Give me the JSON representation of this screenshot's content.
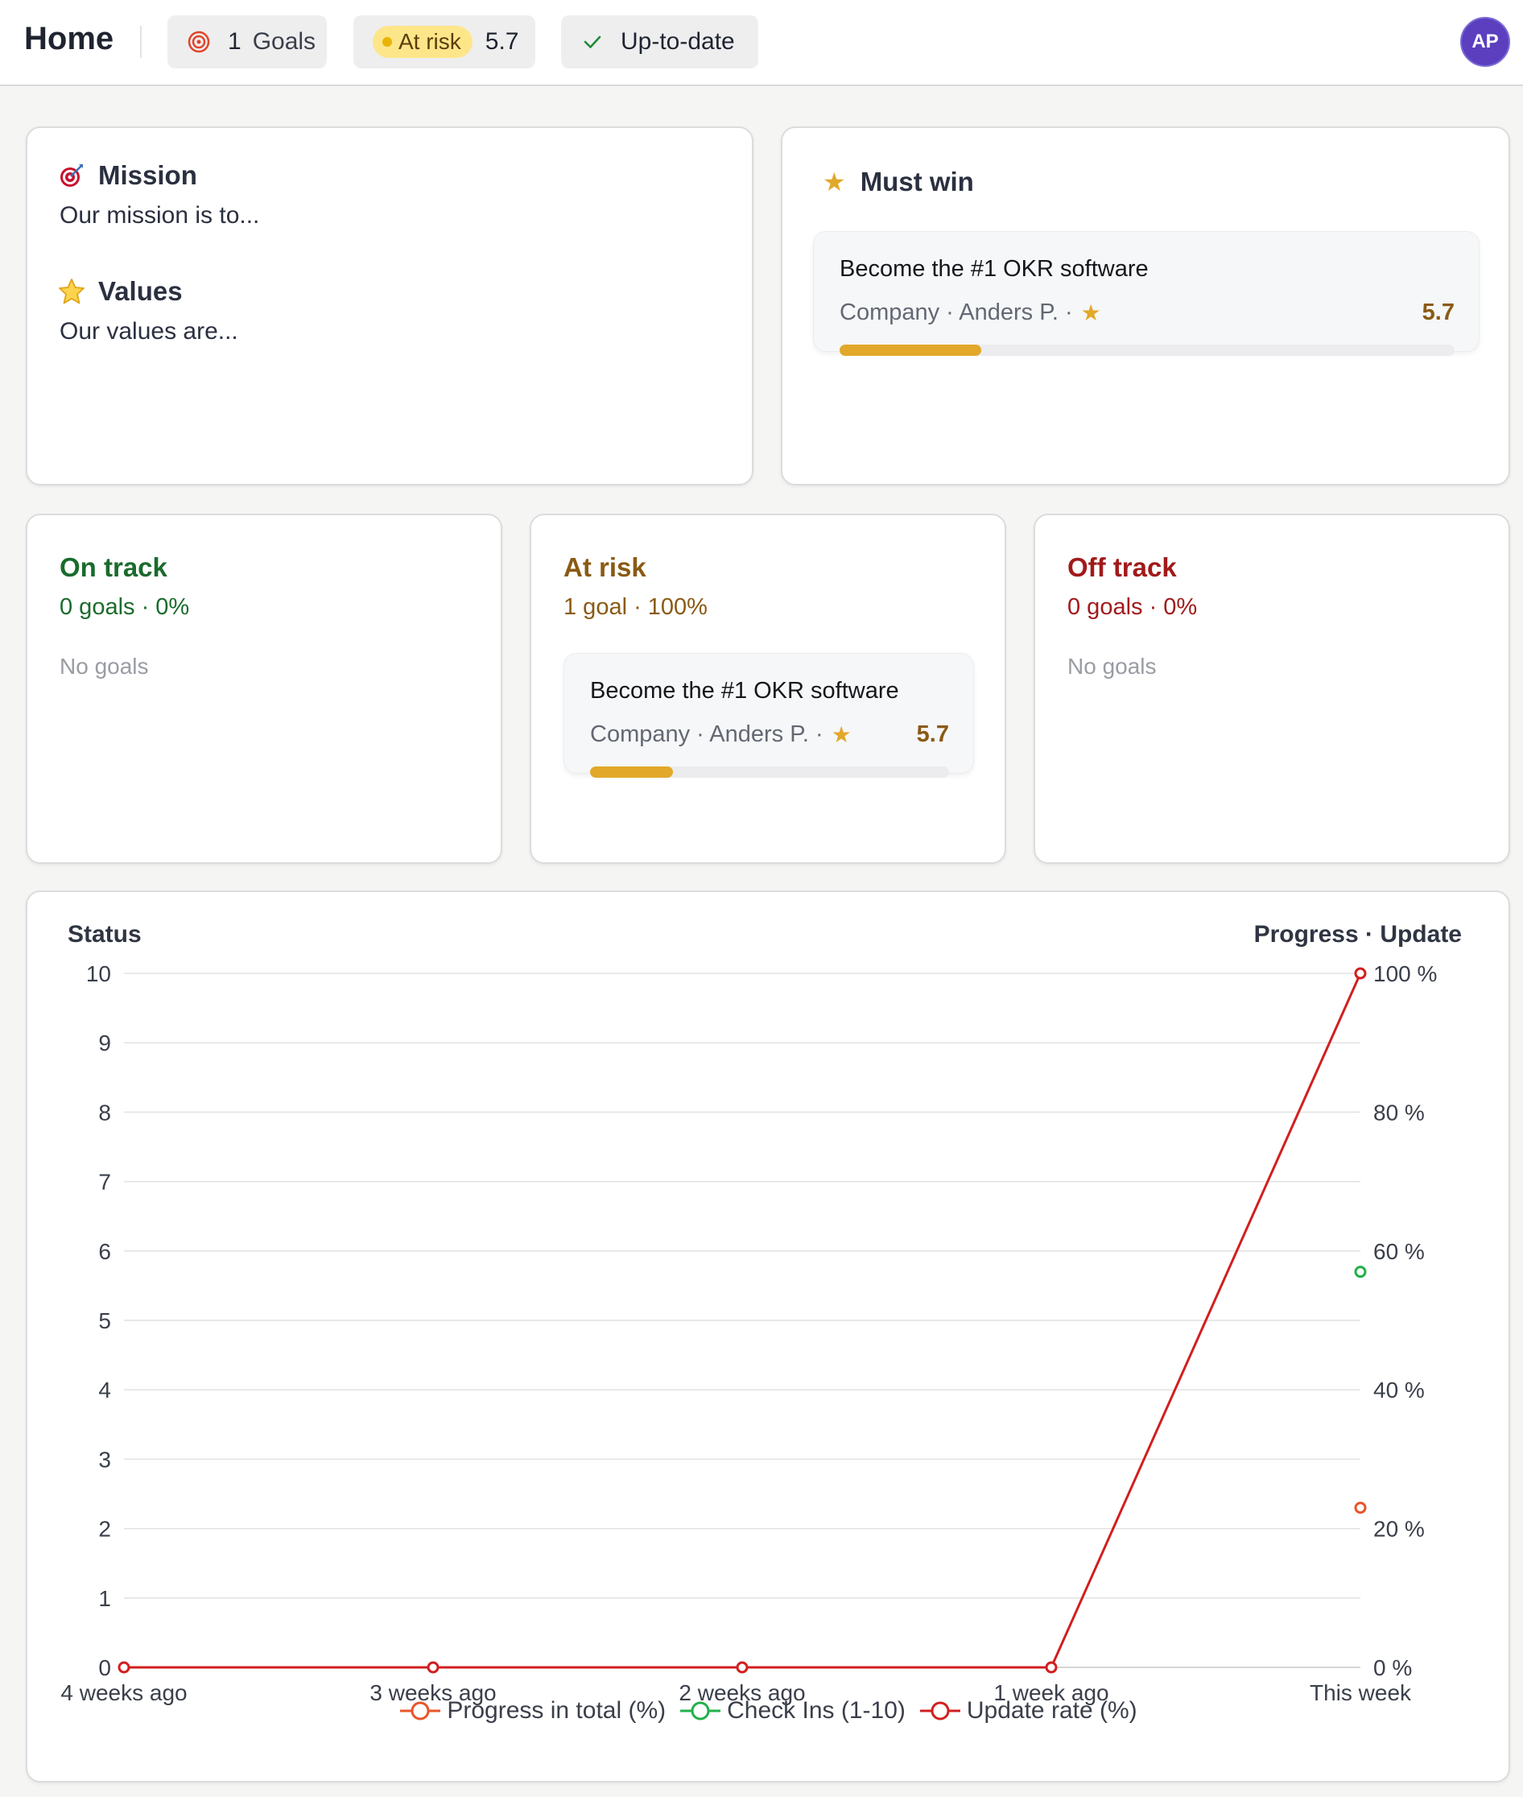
{
  "header": {
    "title": "Home",
    "goals_count": "1",
    "goals_label": "Goals",
    "status_label": "At risk",
    "status_score": "5.7",
    "sync_label": "Up-to-date",
    "avatar_initials": "AP"
  },
  "mission": {
    "mission_title": "Mission",
    "mission_text": "Our mission is to...",
    "values_title": "Values",
    "values_text": "Our values are..."
  },
  "must_win": {
    "title": "Must win",
    "goal": {
      "title": "Become the #1 OKR software",
      "meta": "Company · Anders P. ·",
      "score": "5.7",
      "progress": 0.23
    }
  },
  "status_columns": [
    {
      "title": "On track",
      "summary": "0 goals · 0%",
      "empty_text": "No goals",
      "color": "#1a6b2d"
    },
    {
      "title": "At risk",
      "summary": "1 goal · 100%",
      "color": "#8a5a14",
      "goal": {
        "title": "Become the #1 OKR software",
        "meta": "Company · Anders P. ·",
        "score": "5.7",
        "progress": 0.23
      }
    },
    {
      "title": "Off track",
      "summary": "0 goals · 0%",
      "empty_text": "No goals",
      "color": "#a11a1a"
    }
  ],
  "chart_data": {
    "type": "line",
    "left_axis_label": "Status",
    "right_axis_label": "Progress · Update",
    "categories": [
      "4 weeks ago",
      "3 weeks ago",
      "2 weeks ago",
      "1 week ago",
      "This week"
    ],
    "left_ylim": [
      0,
      10
    ],
    "left_ticks": [
      "0",
      "1",
      "2",
      "3",
      "4",
      "5",
      "6",
      "7",
      "8",
      "9",
      "10"
    ],
    "right_ylim": [
      0,
      100
    ],
    "right_ticks": [
      "0 %",
      "20 %",
      "40 %",
      "60 %",
      "80 %",
      "100 %"
    ],
    "grid": true,
    "legend_position": "bottom",
    "series": [
      {
        "name": "Progress in total (%)",
        "axis": "right",
        "color": "#e8542a",
        "values": [
          null,
          null,
          null,
          null,
          23
        ]
      },
      {
        "name": "Check Ins (1-10)",
        "axis": "left",
        "color": "#22b04a",
        "values": [
          null,
          null,
          null,
          null,
          5.7
        ]
      },
      {
        "name": "Update rate (%)",
        "axis": "right",
        "color": "#d11f1f",
        "values": [
          0,
          0,
          0,
          0,
          100
        ]
      }
    ]
  }
}
